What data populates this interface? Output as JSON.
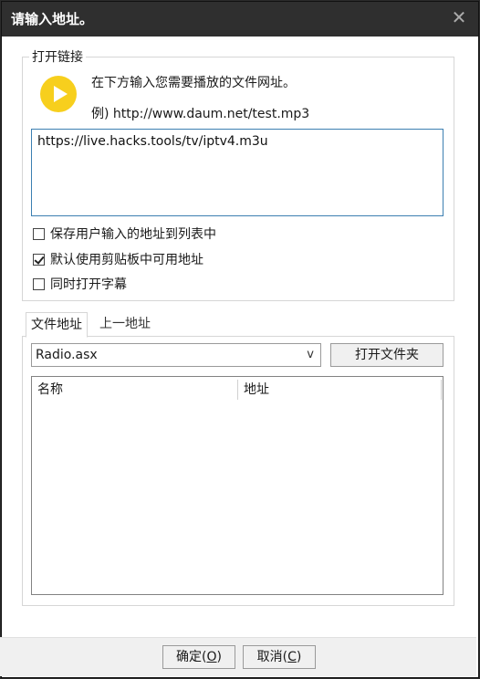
{
  "dialog": {
    "title": "请输入地址。",
    "close_glyph": "✕"
  },
  "open_link": {
    "group_label": "打开链接",
    "instruction": "在下方输入您需要播放的文件网址。",
    "example": "例) http://www.daum.net/test.mp3",
    "url_value": "https://live.hacks.tools/tv/iptv4.m3u"
  },
  "options": [
    {
      "label": "保存用户输入的地址到列表中",
      "checked": false
    },
    {
      "label": "默认使用剪贴板中可用地址",
      "checked": true
    },
    {
      "label": "同时打开字幕",
      "checked": false
    }
  ],
  "tabs": {
    "active": "文件地址",
    "inactive": "上一地址"
  },
  "file_select": {
    "value": "Radio.asx",
    "chevron": "v"
  },
  "open_folder_button": "打开文件夹",
  "table": {
    "columns": [
      "名称",
      "地址"
    ]
  },
  "footer": {
    "ok_label": "确定(",
    "ok_key": "O",
    "ok_end": ")",
    "cancel_label": "取消(",
    "cancel_key": "C",
    "cancel_end": ")"
  }
}
